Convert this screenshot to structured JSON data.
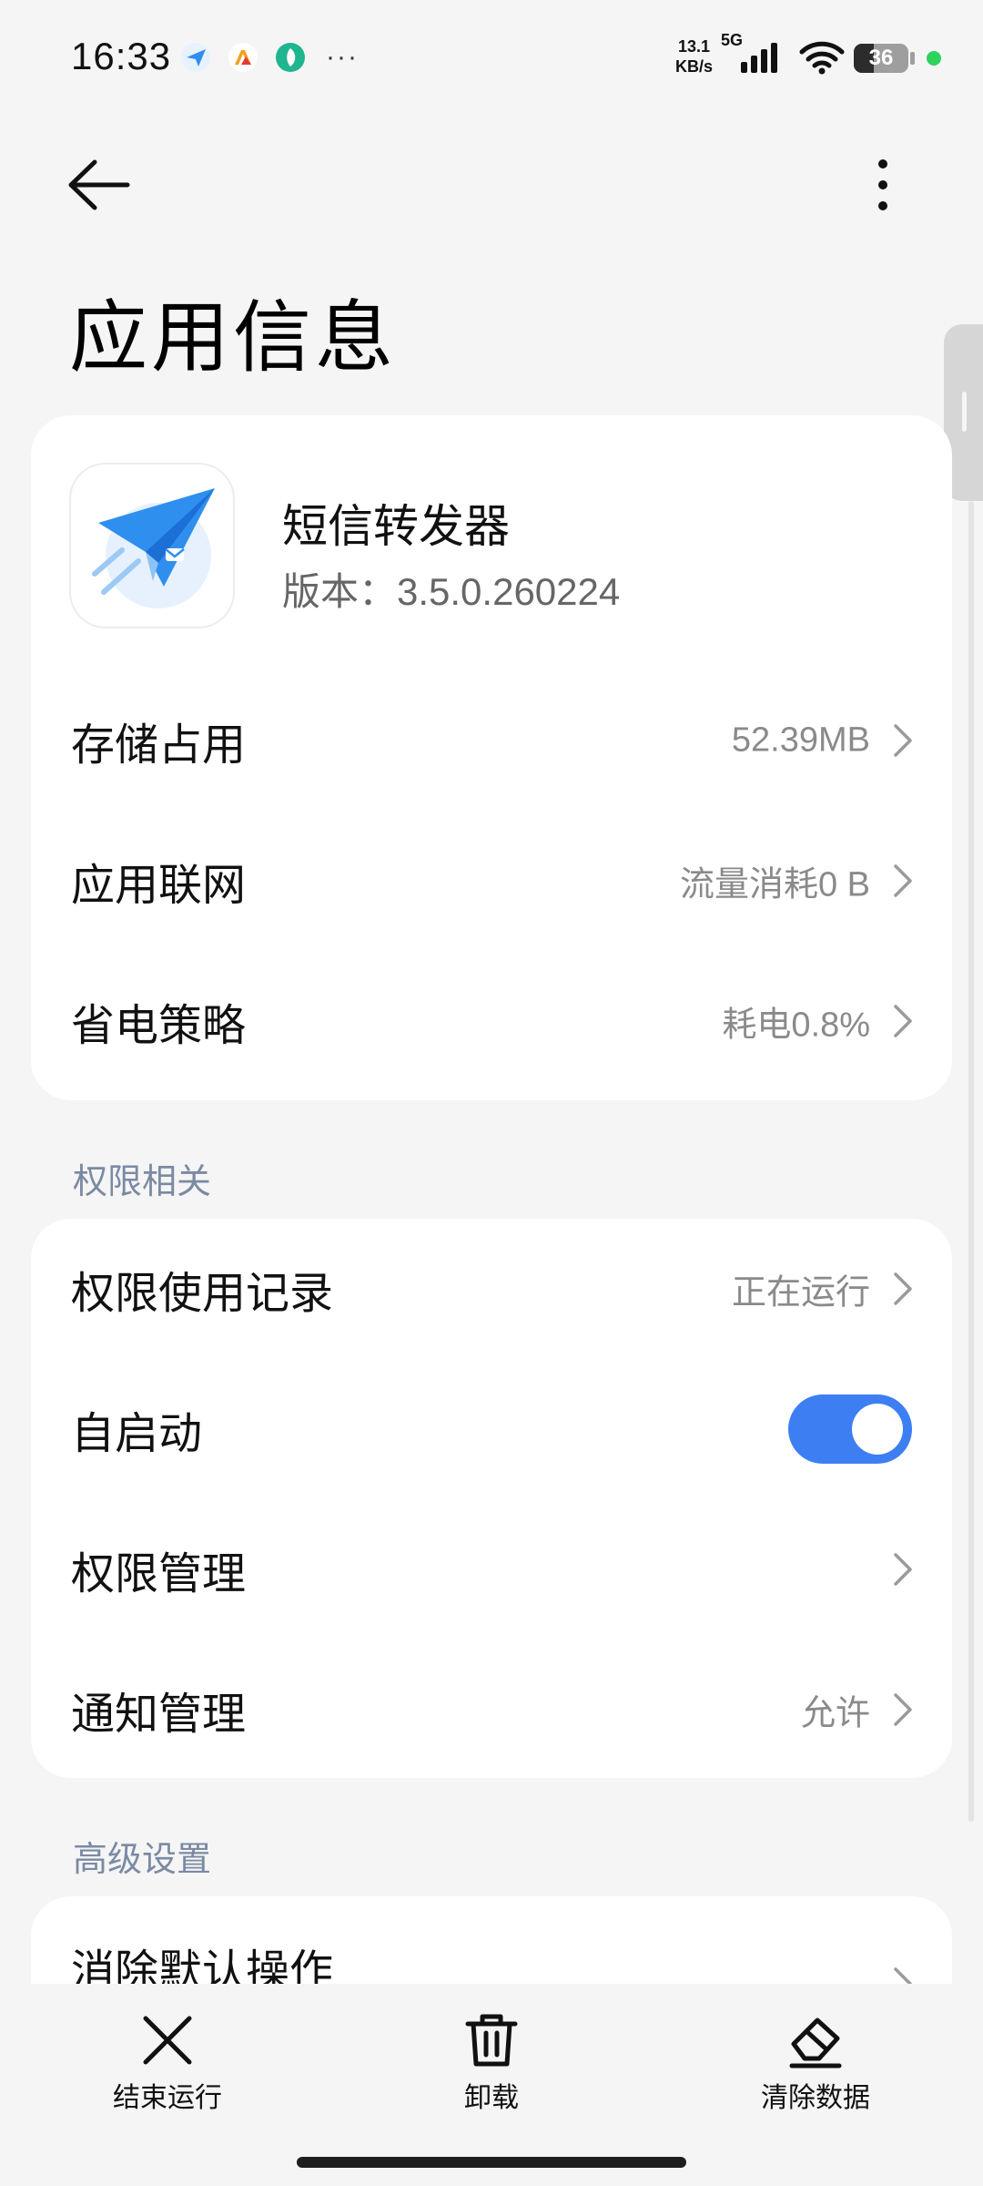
{
  "status_bar": {
    "time": "16:33",
    "app_icons": [
      "paper-plane-icon",
      "a-logo-icon",
      "leaf-icon"
    ],
    "overflow": "···",
    "net_speed_value": "13.1",
    "net_speed_unit": "KB/s",
    "network_type": "5G",
    "battery_level": "36",
    "battery_fraction": 0.36,
    "privacy_dot_color": "#2ed35e"
  },
  "header": {
    "title": "应用信息"
  },
  "app": {
    "name": "短信转发器",
    "version": "版本：3.5.0.260224"
  },
  "info_rows": [
    {
      "label": "存储占用",
      "value": "52.39MB"
    },
    {
      "label": "应用联网",
      "value": "流量消耗0 B"
    },
    {
      "label": "省电策略",
      "value": "耗电0.8%"
    }
  ],
  "permissions_section": {
    "title": "权限相关",
    "rows": [
      {
        "label": "权限使用记录",
        "value": "正在运行"
      },
      {
        "label": "自启动",
        "toggle_on": true
      },
      {
        "label": "权限管理",
        "value": ""
      },
      {
        "label": "通知管理",
        "value": "允许"
      }
    ]
  },
  "advanced_section": {
    "title": "高级设置",
    "rows": [
      {
        "label": "消除默认操作"
      }
    ]
  },
  "actions": [
    {
      "label": "结束运行",
      "icon": "close-icon"
    },
    {
      "label": "卸载",
      "icon": "trash-icon"
    },
    {
      "label": "清除数据",
      "icon": "eraser-icon"
    }
  ],
  "colors": {
    "accent": "#3d7ef3",
    "section_header": "#7b8aa3"
  }
}
